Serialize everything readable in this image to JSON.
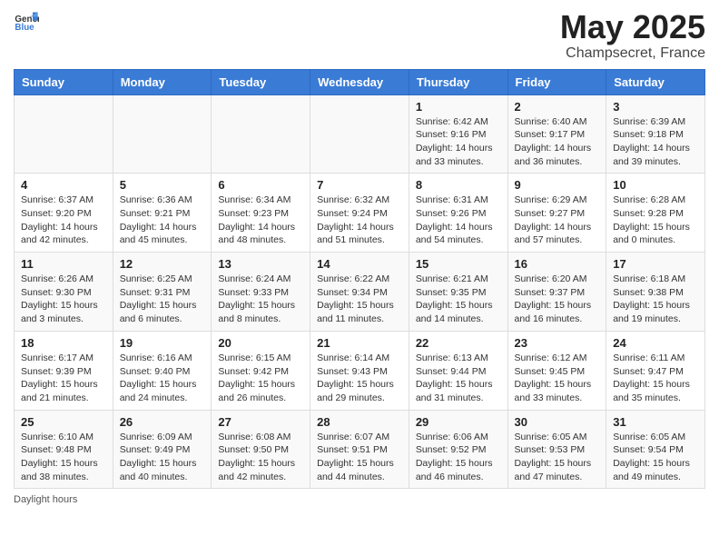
{
  "logo": {
    "general": "General",
    "blue": "Blue"
  },
  "title": "May 2025",
  "subtitle": "Champsecret, France",
  "weekdays": [
    "Sunday",
    "Monday",
    "Tuesday",
    "Wednesday",
    "Thursday",
    "Friday",
    "Saturday"
  ],
  "weeks": [
    [
      {
        "day": "",
        "details": ""
      },
      {
        "day": "",
        "details": ""
      },
      {
        "day": "",
        "details": ""
      },
      {
        "day": "",
        "details": ""
      },
      {
        "day": "1",
        "details": "Sunrise: 6:42 AM\nSunset: 9:16 PM\nDaylight: 14 hours\nand 33 minutes."
      },
      {
        "day": "2",
        "details": "Sunrise: 6:40 AM\nSunset: 9:17 PM\nDaylight: 14 hours\nand 36 minutes."
      },
      {
        "day": "3",
        "details": "Sunrise: 6:39 AM\nSunset: 9:18 PM\nDaylight: 14 hours\nand 39 minutes."
      }
    ],
    [
      {
        "day": "4",
        "details": "Sunrise: 6:37 AM\nSunset: 9:20 PM\nDaylight: 14 hours\nand 42 minutes."
      },
      {
        "day": "5",
        "details": "Sunrise: 6:36 AM\nSunset: 9:21 PM\nDaylight: 14 hours\nand 45 minutes."
      },
      {
        "day": "6",
        "details": "Sunrise: 6:34 AM\nSunset: 9:23 PM\nDaylight: 14 hours\nand 48 minutes."
      },
      {
        "day": "7",
        "details": "Sunrise: 6:32 AM\nSunset: 9:24 PM\nDaylight: 14 hours\nand 51 minutes."
      },
      {
        "day": "8",
        "details": "Sunrise: 6:31 AM\nSunset: 9:26 PM\nDaylight: 14 hours\nand 54 minutes."
      },
      {
        "day": "9",
        "details": "Sunrise: 6:29 AM\nSunset: 9:27 PM\nDaylight: 14 hours\nand 57 minutes."
      },
      {
        "day": "10",
        "details": "Sunrise: 6:28 AM\nSunset: 9:28 PM\nDaylight: 15 hours\nand 0 minutes."
      }
    ],
    [
      {
        "day": "11",
        "details": "Sunrise: 6:26 AM\nSunset: 9:30 PM\nDaylight: 15 hours\nand 3 minutes."
      },
      {
        "day": "12",
        "details": "Sunrise: 6:25 AM\nSunset: 9:31 PM\nDaylight: 15 hours\nand 6 minutes."
      },
      {
        "day": "13",
        "details": "Sunrise: 6:24 AM\nSunset: 9:33 PM\nDaylight: 15 hours\nand 8 minutes."
      },
      {
        "day": "14",
        "details": "Sunrise: 6:22 AM\nSunset: 9:34 PM\nDaylight: 15 hours\nand 11 minutes."
      },
      {
        "day": "15",
        "details": "Sunrise: 6:21 AM\nSunset: 9:35 PM\nDaylight: 15 hours\nand 14 minutes."
      },
      {
        "day": "16",
        "details": "Sunrise: 6:20 AM\nSunset: 9:37 PM\nDaylight: 15 hours\nand 16 minutes."
      },
      {
        "day": "17",
        "details": "Sunrise: 6:18 AM\nSunset: 9:38 PM\nDaylight: 15 hours\nand 19 minutes."
      }
    ],
    [
      {
        "day": "18",
        "details": "Sunrise: 6:17 AM\nSunset: 9:39 PM\nDaylight: 15 hours\nand 21 minutes."
      },
      {
        "day": "19",
        "details": "Sunrise: 6:16 AM\nSunset: 9:40 PM\nDaylight: 15 hours\nand 24 minutes."
      },
      {
        "day": "20",
        "details": "Sunrise: 6:15 AM\nSunset: 9:42 PM\nDaylight: 15 hours\nand 26 minutes."
      },
      {
        "day": "21",
        "details": "Sunrise: 6:14 AM\nSunset: 9:43 PM\nDaylight: 15 hours\nand 29 minutes."
      },
      {
        "day": "22",
        "details": "Sunrise: 6:13 AM\nSunset: 9:44 PM\nDaylight: 15 hours\nand 31 minutes."
      },
      {
        "day": "23",
        "details": "Sunrise: 6:12 AM\nSunset: 9:45 PM\nDaylight: 15 hours\nand 33 minutes."
      },
      {
        "day": "24",
        "details": "Sunrise: 6:11 AM\nSunset: 9:47 PM\nDaylight: 15 hours\nand 35 minutes."
      }
    ],
    [
      {
        "day": "25",
        "details": "Sunrise: 6:10 AM\nSunset: 9:48 PM\nDaylight: 15 hours\nand 38 minutes."
      },
      {
        "day": "26",
        "details": "Sunrise: 6:09 AM\nSunset: 9:49 PM\nDaylight: 15 hours\nand 40 minutes."
      },
      {
        "day": "27",
        "details": "Sunrise: 6:08 AM\nSunset: 9:50 PM\nDaylight: 15 hours\nand 42 minutes."
      },
      {
        "day": "28",
        "details": "Sunrise: 6:07 AM\nSunset: 9:51 PM\nDaylight: 15 hours\nand 44 minutes."
      },
      {
        "day": "29",
        "details": "Sunrise: 6:06 AM\nSunset: 9:52 PM\nDaylight: 15 hours\nand 46 minutes."
      },
      {
        "day": "30",
        "details": "Sunrise: 6:05 AM\nSunset: 9:53 PM\nDaylight: 15 hours\nand 47 minutes."
      },
      {
        "day": "31",
        "details": "Sunrise: 6:05 AM\nSunset: 9:54 PM\nDaylight: 15 hours\nand 49 minutes."
      }
    ]
  ],
  "footer": "Daylight hours"
}
